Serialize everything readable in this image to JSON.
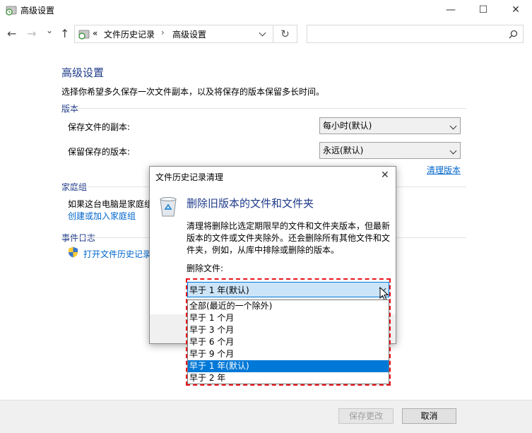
{
  "window": {
    "title": "高级设置",
    "minimize_glyph": "—",
    "maximize_glyph": "☐",
    "close_glyph": "✕"
  },
  "nav": {
    "back_glyph": "←",
    "forward_glyph": "→",
    "recent_glyph": "⌄",
    "up_glyph": "↑",
    "breadcrumb_overflow": "«",
    "breadcrumb": [
      "文件历史记录",
      "高级设置"
    ],
    "breadcrumb_sep": "›",
    "refresh_glyph": "↻",
    "search_placeholder": ""
  },
  "main": {
    "heading": "高级设置",
    "description": "选择你希望多久保存一次文件副本，以及将保存的版本保留多长时间。",
    "versions": {
      "title": "版本",
      "save_copies_label": "保存文件的副本:",
      "save_copies_value": "每小时(默认)",
      "keep_versions_label": "保留保存的版本:",
      "keep_versions_value": "永远(默认)",
      "cleanup_link": "清理版本"
    },
    "homegroup": {
      "title": "家庭组",
      "text": "如果这台电脑是家庭组",
      "link": "创建或加入家庭组"
    },
    "event_log": {
      "title": "事件日志",
      "link": "打开文件历史记录"
    }
  },
  "footer": {
    "save_label": "保存更改",
    "cancel_label": "取消"
  },
  "dialog": {
    "title": "文件历史记录清理",
    "close_glyph": "✕",
    "heading": "删除旧版本的文件和文件夹",
    "line1": "清理将删除比选定期限早的文件和文件夹版本，但最新",
    "line2": "版本的文件或文件夹除外。还会删除所有其他文件和文",
    "line3": "件夹，例如，从库中排除或删除的版本。",
    "delete_label": "删除文件:",
    "selected": "早于 1 年(默认)",
    "options": [
      "全部(最近的一个除外)",
      "早于 1 个月",
      "早于 3 个月",
      "早于 6 个月",
      "早于 9 个月",
      "早于 1 年(默认)",
      "早于 2 年"
    ]
  },
  "colors": {
    "accent": "#0078d7",
    "heading_blue": "#1e3a8a",
    "link_blue": "#0066cc",
    "highlight_outline": "#e8141b"
  }
}
